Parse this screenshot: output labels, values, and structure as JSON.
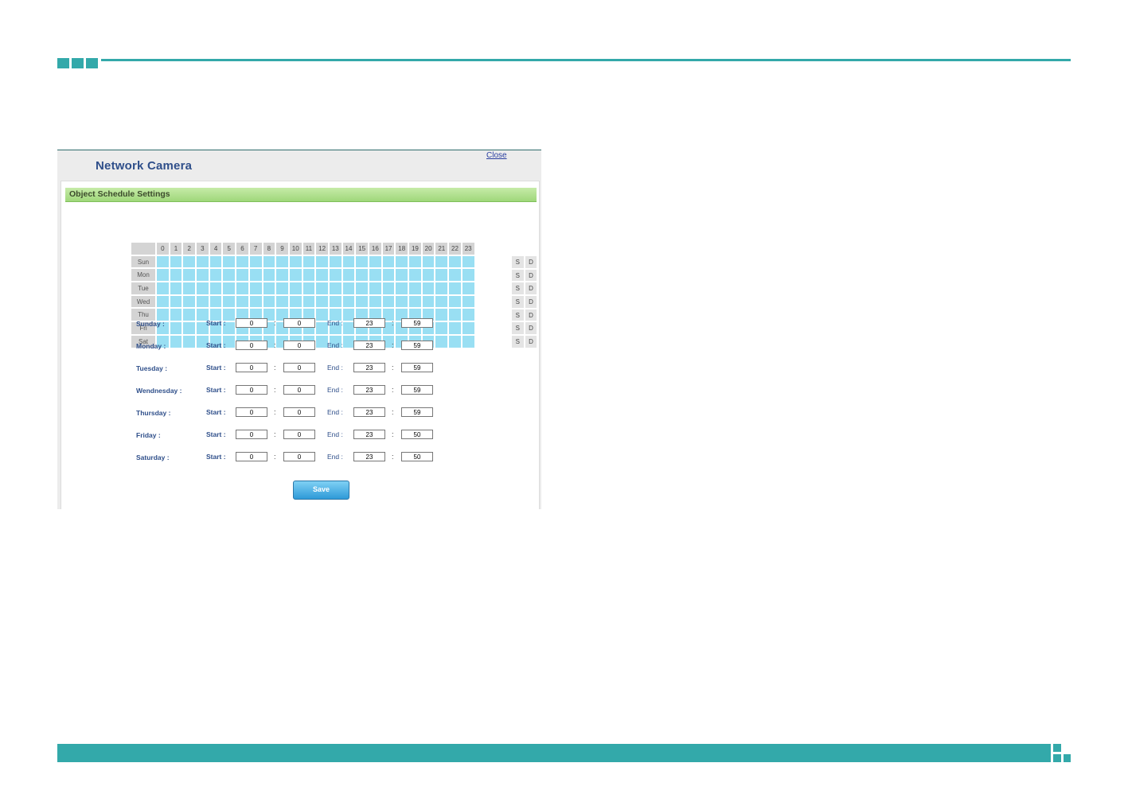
{
  "app": {
    "brand": "Network Camera",
    "close_label": "Close"
  },
  "section": {
    "title": "Object Schedule Settings"
  },
  "grid": {
    "hours": [
      "0",
      "1",
      "2",
      "3",
      "4",
      "5",
      "6",
      "7",
      "8",
      "9",
      "10",
      "11",
      "12",
      "13",
      "14",
      "15",
      "16",
      "17",
      "18",
      "19",
      "20",
      "21",
      "22",
      "23"
    ],
    "days": [
      "Sun",
      "Mon",
      "Tue",
      "Wed",
      "Thu",
      "Fri",
      "Sat"
    ],
    "all_hours_selected": true,
    "selected_color": "#99dff3",
    "quick_buttons": [
      "S",
      "D"
    ]
  },
  "times": {
    "start_label": "Start :",
    "end_label": "End :",
    "colon": ":",
    "rows": [
      {
        "day": "Sunday :",
        "start_h": "0",
        "start_m": "0",
        "end_h": "23",
        "end_m": "59"
      },
      {
        "day": "Monday :",
        "start_h": "0",
        "start_m": "0",
        "end_h": "23",
        "end_m": "59"
      },
      {
        "day": "Tuesday :",
        "start_h": "0",
        "start_m": "0",
        "end_h": "23",
        "end_m": "59"
      },
      {
        "day": "Wendnesday :",
        "start_h": "0",
        "start_m": "0",
        "end_h": "23",
        "end_m": "59"
      },
      {
        "day": "Thursday :",
        "start_h": "0",
        "start_m": "0",
        "end_h": "23",
        "end_m": "59"
      },
      {
        "day": "Friday :",
        "start_h": "0",
        "start_m": "0",
        "end_h": "23",
        "end_m": "50"
      },
      {
        "day": "Saturday :",
        "start_h": "0",
        "start_m": "0",
        "end_h": "23",
        "end_m": "50"
      }
    ]
  },
  "save_label": "Save",
  "colors": {
    "accent": "#33a9aa",
    "header_green": "#9fd77a",
    "label_blue": "#2f4f8a",
    "button_blue": "#2e9ad8"
  }
}
